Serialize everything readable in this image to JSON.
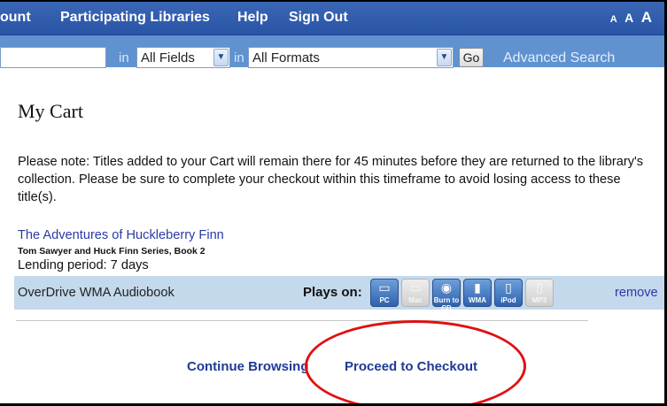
{
  "nav": {
    "account": "ount",
    "libraries": "Participating Libraries",
    "help": "Help",
    "signout": "Sign Out",
    "font_small": "A",
    "font_medium": "A",
    "font_large": "A"
  },
  "search": {
    "query_value": "",
    "in_label_1": "in",
    "field_value": "All Fields",
    "in_label_2": "in",
    "format_value": "All Formats",
    "go_label": "Go",
    "advanced_label": "Advanced Search"
  },
  "page": {
    "title": "My Cart",
    "note": "Please note: Titles added to your Cart will remain there for 45 minutes before they are returned to the library's collection. Please be sure to complete your checkout within this timeframe to avoid losing access to these title(s)."
  },
  "cart_item": {
    "title": "The Adventures of Huckleberry Finn",
    "series": "Tom Sawyer and Huck Finn Series, Book 2",
    "lending": "Lending period: 7 days",
    "format": "OverDrive WMA Audiobook",
    "plays_on_label": "Plays on:",
    "remove_label": "remove",
    "devices": [
      {
        "name": "pc-icon",
        "label": "PC",
        "glyph": "▭",
        "enabled": true
      },
      {
        "name": "mac-icon",
        "label": "Mac",
        "glyph": "▭",
        "enabled": false
      },
      {
        "name": "burn-cd-icon",
        "label": "Burn to CD",
        "glyph": "◉",
        "enabled": true
      },
      {
        "name": "wma-icon",
        "label": "WMA",
        "glyph": "▮",
        "enabled": true
      },
      {
        "name": "ipod-icon",
        "label": "iPod",
        "glyph": "▯",
        "enabled": true
      },
      {
        "name": "mp3-icon",
        "label": "MP3",
        "glyph": "▯",
        "enabled": false
      }
    ]
  },
  "actions": {
    "continue_label": "Continue Browsing",
    "checkout_label": "Proceed to Checkout"
  },
  "colors": {
    "nav_bg": "#2a55a6",
    "search_bg": "#5f92cf",
    "format_row_bg": "#c4d9ec",
    "link": "#1e3a94",
    "annotation": "#e01010"
  }
}
